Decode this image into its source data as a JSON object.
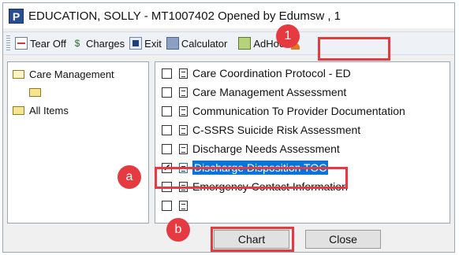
{
  "window": {
    "app_icon_letter": "P",
    "title": "EDUCATION, SOLLY - MT1007402 Opened by Edumsw , 1"
  },
  "toolbar": {
    "tear_off": "Tear Off",
    "charges": "Charges",
    "exit": "Exit",
    "calculator": "Calculator",
    "adhoc": "AdHoc"
  },
  "tree": {
    "items": [
      {
        "label": "Care Management",
        "icon": "folder-open-icon"
      },
      {
        "label": "",
        "icon": "folder-icon"
      },
      {
        "label": "All Items",
        "icon": "folder-icon"
      }
    ]
  },
  "list": {
    "items": [
      {
        "label": "Care Coordination Protocol - ED",
        "checked": false
      },
      {
        "label": "Care Management Assessment",
        "checked": false
      },
      {
        "label": "Communication To Provider Documentation",
        "checked": false
      },
      {
        "label": "C-SSRS Suicide Risk Assessment",
        "checked": false
      },
      {
        "label": "Discharge Needs Assessment",
        "checked": false
      },
      {
        "label": "Discharge Disposition TOC",
        "checked": true,
        "selected": true
      },
      {
        "label": "Emergency Contact Information",
        "checked": false
      },
      {
        "label": "",
        "checked": false
      }
    ]
  },
  "buttons": {
    "chart": "Chart",
    "close": "Close"
  },
  "annotations": {
    "step_1": "1",
    "step_a": "a",
    "step_b": "b",
    "color": "#e53a40"
  },
  "colors": {
    "selection": "#0a74d8",
    "app_icon": "#2a4d8f"
  }
}
